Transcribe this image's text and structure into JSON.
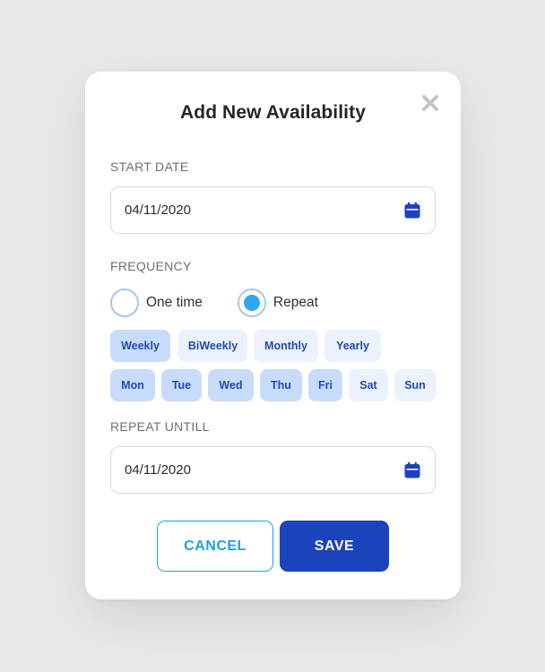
{
  "dialog": {
    "title": "Add New Availability",
    "close_icon": "close-x-icon"
  },
  "start_date": {
    "label": "START DATE",
    "value": "04/11/2020",
    "icon": "calendar-icon"
  },
  "frequency": {
    "label": "FREQUENCY",
    "options": [
      {
        "label": "One time",
        "selected": false
      },
      {
        "label": "Repeat",
        "selected": true
      }
    ]
  },
  "repeat_types": [
    {
      "label": "Weekly",
      "selected": true
    },
    {
      "label": "BiWeekly",
      "selected": false
    },
    {
      "label": "Monthly",
      "selected": false
    },
    {
      "label": "Yearly",
      "selected": false
    }
  ],
  "days": [
    {
      "label": "Mon",
      "selected": true
    },
    {
      "label": "Tue",
      "selected": true
    },
    {
      "label": "Wed",
      "selected": true
    },
    {
      "label": "Thu",
      "selected": true
    },
    {
      "label": "Fri",
      "selected": true
    },
    {
      "label": "Sat",
      "selected": false
    },
    {
      "label": "Sun",
      "selected": false
    }
  ],
  "repeat_until": {
    "label": "REPEAT UNTILL",
    "value": "04/11/2020",
    "icon": "calendar-icon"
  },
  "actions": {
    "cancel_label": "CANCEL",
    "save_label": "SAVE"
  },
  "colors": {
    "primary": "#1c43be",
    "accent": "#1f9ee8",
    "radio_fill": "#2fa7f6",
    "chip_selected": "#c7dcfb",
    "chip_unselected": "#ebf2fd",
    "chip_text": "#2249b5"
  }
}
